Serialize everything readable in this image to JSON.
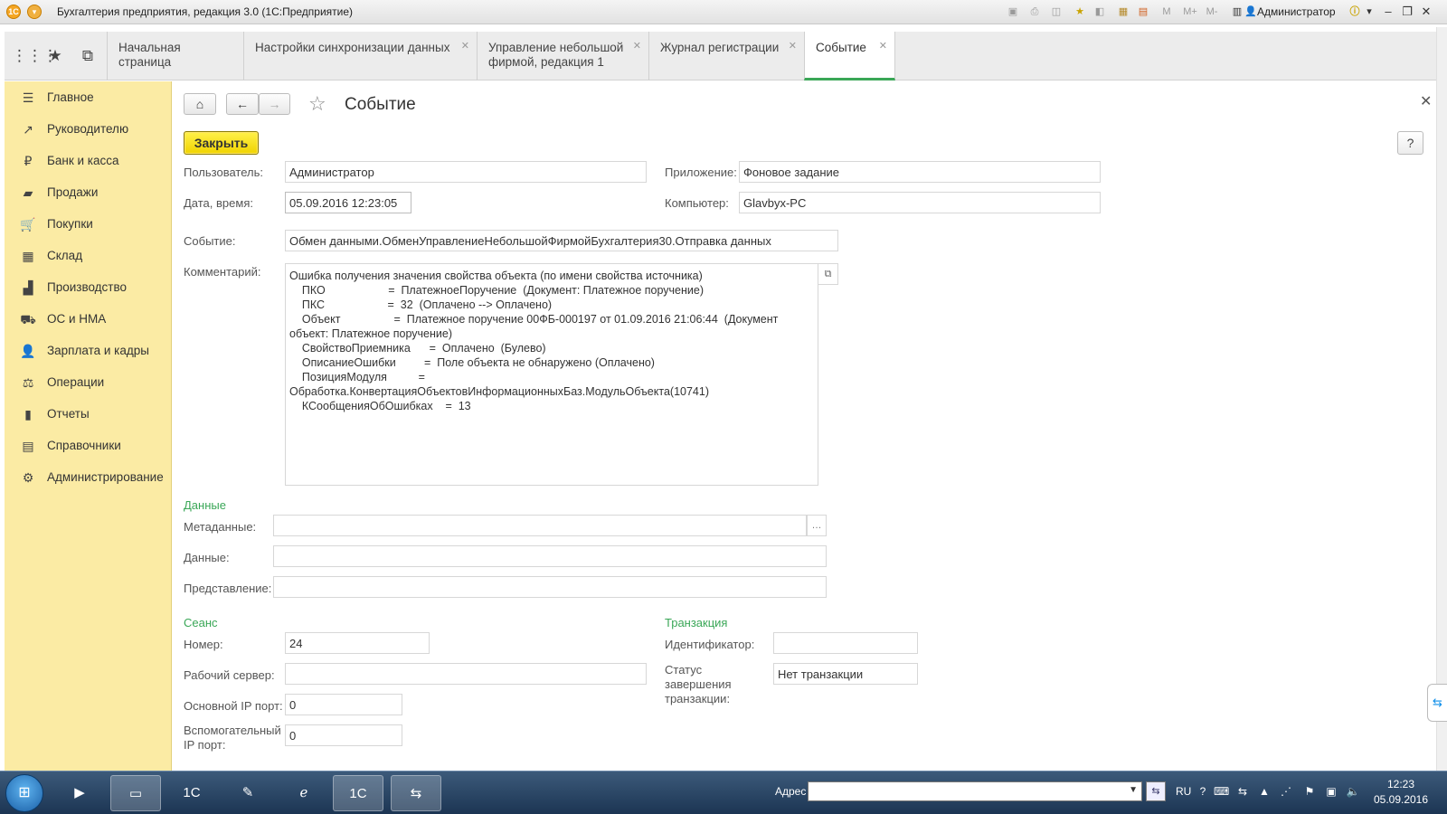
{
  "window": {
    "title": "Бухгалтерия предприятия, редакция 3.0  (1С:Предприятие)",
    "user": "Администратор"
  },
  "tabs": [
    {
      "label": "Начальная страница",
      "closable": false
    },
    {
      "label": "Настройки синхронизации данных",
      "closable": true
    },
    {
      "label": "Управление небольшой фирмой, редакция 1",
      "closable": true
    },
    {
      "label": "Журнал регистрации",
      "closable": true
    },
    {
      "label": "Событие",
      "closable": true,
      "active": true
    }
  ],
  "sidebar": {
    "items": [
      {
        "label": "Главное",
        "icon": "menu-icon"
      },
      {
        "label": "Руководителю",
        "icon": "trend-icon"
      },
      {
        "label": "Банк и касса",
        "icon": "ruble-icon"
      },
      {
        "label": "Продажи",
        "icon": "bag-icon"
      },
      {
        "label": "Покупки",
        "icon": "cart-icon"
      },
      {
        "label": "Склад",
        "icon": "warehouse-icon"
      },
      {
        "label": "Производство",
        "icon": "factory-icon"
      },
      {
        "label": "ОС и НМА",
        "icon": "truck-icon"
      },
      {
        "label": "Зарплата и кадры",
        "icon": "person-icon"
      },
      {
        "label": "Операции",
        "icon": "scales-icon"
      },
      {
        "label": "Отчеты",
        "icon": "bar-chart-icon"
      },
      {
        "label": "Справочники",
        "icon": "book-icon"
      },
      {
        "label": "Администрирование",
        "icon": "gear-icon"
      }
    ]
  },
  "form": {
    "title": "Событие",
    "close_button": "Закрыть",
    "help_button": "?",
    "user_label": "Пользователь:",
    "user_value": "Администратор",
    "app_label": "Приложение:",
    "app_value": "Фоновое задание",
    "datetime_label": "Дата, время:",
    "datetime_value": "05.09.2016 12:23:05",
    "computer_label": "Компьютер:",
    "computer_value": "Glavbyx-PC",
    "event_label": "Событие:",
    "event_value": "Обмен данными.ОбменУправлениеНебольшойФирмойБухгалтерия30.Отправка данных",
    "comment_label": "Комментарий:",
    "comment_lines": [
      "Ошибка получения значения свойства объекта (по имени свойства источника)",
      "    ПКО                    =  ПлатежноеПоручение  (Документ: Платежное поручение)",
      "    ПКС                    =  32  (Оплачено --> Оплачено)",
      "    Объект                 =  Платежное поручение 00ФБ-000197 от 01.09.2016 21:06:44  (Документ объект: Платежное поручение)",
      "    СвойствоПриемника      =  Оплачено  (Булево)",
      "    ОписаниеОшибки         =  Поле объекта не обнаружено (Оплачено)",
      "    ПозицияМодуля          =  Обработка.КонвертацияОбъектовИнформационныхБаз.МодульОбъекта(10741)",
      "    КСообщенияОбОшибках    =  13"
    ],
    "data_section": "Данные",
    "metadata_label": "Метаданные:",
    "metadata_value": "",
    "data_label": "Данные:",
    "data_value": "",
    "presentation_label": "Представление:",
    "presentation_value": "",
    "session_section": "Сеанс",
    "number_label": "Номер:",
    "number_value": "24",
    "server_label": "Рабочий сервер:",
    "server_value": "",
    "main_ip_label": "Основной IP порт:",
    "main_ip_value": "0",
    "aux_ip_label": "Вспомогательный IP порт:",
    "aux_ip_value": "0",
    "transaction_section": "Транзакция",
    "id_label": "Идентификатор:",
    "id_value": "",
    "status_label": "Статус завершения транзакции:",
    "status_value": "Нет транзакции"
  },
  "taskbar": {
    "address_label": "Адрес",
    "address_value": "",
    "language": "RU",
    "time": "12:23",
    "date": "05.09.2016"
  },
  "colors": {
    "sidebar_bg": "#fbeba4",
    "accent_green": "#3aa757",
    "close_button_yellow": "#f5dd12"
  }
}
